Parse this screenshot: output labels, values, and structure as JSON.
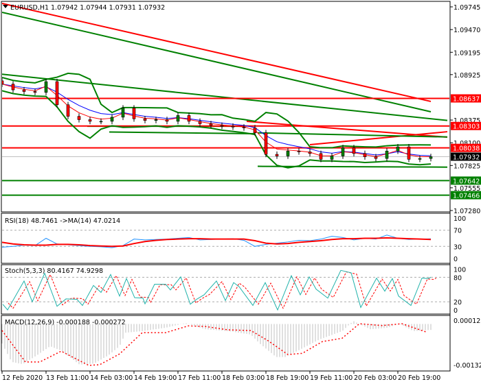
{
  "header": {
    "symbol_tf": "EURUSD,H1",
    "ohlc": "1.07942 1.07944 1.07931 1.07932"
  },
  "chart_data": [
    {
      "type": "candlestick",
      "title": "EURUSD,H1",
      "ylim": [
        1.0728,
        1.09745
      ],
      "price_ticks": [
        "1.09745",
        "1.09470",
        "1.09195",
        "1.08925",
        "1.08375",
        "1.08100",
        "1.07825",
        "1.07555",
        "1.07280"
      ],
      "time_labels": [
        "12 Feb 2020",
        "13 Feb 11:00",
        "14 Feb 03:00",
        "14 Feb 19:00",
        "17 Feb 11:00",
        "18 Feb 03:00",
        "18 Feb 19:00",
        "19 Feb 11:00",
        "20 Feb 03:00",
        "20 Feb 19:00"
      ],
      "hours_between_time_labels": 16,
      "close_step_hours": 4,
      "closes": [
        1.0881,
        1.0874,
        1.0872,
        1.0871,
        1.0884,
        1.0856,
        1.0842,
        1.0838,
        1.0836,
        1.0836,
        1.0841,
        1.0852,
        1.0839,
        1.0837,
        1.0838,
        1.0836,
        1.0843,
        1.0836,
        1.0833,
        1.0831,
        1.083,
        1.0829,
        1.0828,
        1.0822,
        1.0796,
        1.0794,
        1.08,
        1.0799,
        1.0797,
        1.079,
        1.0794,
        1.0804,
        1.0797,
        1.0793,
        1.0791,
        1.08,
        1.0805,
        1.079,
        1.0791,
        1.07932
      ],
      "levels": [
        {
          "price": "1.08637",
          "color": "#ff0000"
        },
        {
          "price": "1.08303",
          "color": "#ff0000"
        },
        {
          "price": "1.08038",
          "color": "#ff0000"
        },
        {
          "price": "1.07932",
          "color": "#000000",
          "current": true
        },
        {
          "price": "1.07642",
          "color": "#008000"
        },
        {
          "price": "1.07466",
          "color": "#008000"
        }
      ],
      "trendlines": [
        {
          "color": "#ff0000",
          "from": [
            0,
            1.09787
          ],
          "to": [
            156,
            1.086
          ]
        },
        {
          "color": "#008000",
          "from": [
            0,
            1.09679
          ],
          "to": [
            156,
            1.08475
          ]
        },
        {
          "color": "#008000",
          "from": [
            0,
            1.0893
          ],
          "to": [
            162,
            1.0837
          ]
        },
        {
          "color": "#ff0000",
          "from": [
            89,
            1.08359
          ],
          "to": [
            162,
            1.08168
          ]
        },
        {
          "color": "#ff0000",
          "from": [
            112,
            1.08077
          ],
          "to": [
            162,
            1.08234
          ]
        },
        {
          "color": "#008000",
          "from": [
            31,
            1.083
          ],
          "to": [
            88,
            1.083
          ]
        },
        {
          "color": "#008000",
          "from": [
            39,
            1.0823
          ],
          "to": [
            92,
            1.0821
          ]
        },
        {
          "color": "#008000",
          "from": [
            93,
            1.0822
          ],
          "to": [
            162,
            1.0817
          ]
        },
        {
          "color": "#008000",
          "from": [
            93,
            1.07815
          ],
          "to": [
            162,
            1.07805
          ]
        }
      ]
    },
    {
      "type": "line",
      "title": "RSI(18) 48.7461  ->MA(14) 47.0214",
      "ylim": [
        0,
        100
      ],
      "ticks": [
        "100",
        "70",
        "30",
        "0"
      ],
      "levels": [
        70,
        30
      ],
      "step_hours": 4,
      "rsi": [
        28,
        30,
        33,
        32,
        50,
        36,
        34,
        32,
        30,
        29,
        27,
        32,
        48,
        46,
        47,
        48,
        50,
        52,
        46,
        47,
        48,
        49,
        45,
        30,
        35,
        38,
        41,
        45,
        44,
        48,
        55,
        52,
        46,
        50,
        48,
        58,
        50,
        47,
        48,
        48.75
      ],
      "ma": [
        40,
        36,
        34,
        33,
        33,
        35,
        35,
        34,
        32,
        31,
        30,
        31,
        37,
        42,
        45,
        47,
        48,
        49,
        49,
        48,
        48,
        48,
        48,
        44,
        38,
        36,
        37,
        40,
        42,
        44,
        47,
        49,
        49,
        50,
        50,
        51,
        50,
        49,
        48,
        47.02
      ]
    },
    {
      "type": "line",
      "title": "Stoch(5,3,3) 80.4167 74.9298",
      "ylim": [
        0,
        100
      ],
      "ticks": [
        "100",
        "80",
        "20",
        "0"
      ],
      "levels": [
        80,
        20
      ],
      "k": [
        [
          0.25,
          14
        ],
        [
          2,
          0
        ],
        [
          8,
          71
        ],
        [
          11,
          20
        ],
        [
          15.5,
          90
        ],
        [
          20,
          9
        ],
        [
          23.25,
          27
        ],
        [
          27.25,
          26
        ],
        [
          29.25,
          11
        ],
        [
          33.25,
          60
        ],
        [
          36,
          43
        ],
        [
          39.5,
          87
        ],
        [
          42.75,
          34
        ],
        [
          45.25,
          77
        ],
        [
          48.25,
          30
        ],
        [
          51.25,
          29
        ],
        [
          52,
          15
        ],
        [
          55.5,
          63
        ],
        [
          59.5,
          63
        ],
        [
          61.25,
          49
        ],
        [
          65,
          81
        ],
        [
          68.5,
          14
        ],
        [
          70.75,
          26
        ],
        [
          73.5,
          37
        ],
        [
          78,
          71
        ],
        [
          81.25,
          23
        ],
        [
          84.25,
          67
        ],
        [
          86.25,
          57
        ],
        [
          91.25,
          11
        ],
        [
          95.75,
          67
        ],
        [
          100.25,
          0
        ],
        [
          105.25,
          84
        ],
        [
          108.5,
          37
        ],
        [
          111.75,
          81
        ],
        [
          114.25,
          51
        ],
        [
          118.5,
          29
        ],
        [
          123.25,
          97
        ],
        [
          127,
          91
        ],
        [
          130.5,
          6
        ],
        [
          136.25,
          78
        ],
        [
          139.25,
          46
        ],
        [
          142,
          77
        ],
        [
          144.25,
          34
        ],
        [
          148.75,
          11
        ],
        [
          152.75,
          78
        ],
        [
          155,
          77
        ],
        [
          156,
          80.42
        ]
      ],
      "d_lag_hours": 2
    },
    {
      "type": "bar",
      "title": "MACD(12,26,9) -0.000188 -0.000272",
      "ylim": [
        -0.001322,
        0.000123
      ],
      "ticks": [
        "0.000123",
        "-0.001322"
      ],
      "macd": [
        [
          0,
          -0.00063
        ],
        [
          3.5,
          -0.00123
        ],
        [
          7.5,
          -0.0013
        ],
        [
          12.75,
          -0.00101
        ],
        [
          17.5,
          -0.00072
        ],
        [
          21.5,
          -0.00086
        ],
        [
          28.25,
          -0.00132
        ],
        [
          33.5,
          -0.00128
        ],
        [
          38.75,
          -0.00101
        ],
        [
          42.75,
          -0.00072
        ],
        [
          45,
          -0.00028
        ],
        [
          51,
          -0.00023
        ],
        [
          59.5,
          -0.00012
        ],
        [
          66.75,
          3e-05
        ],
        [
          74,
          -0.00017
        ],
        [
          82.25,
          -0.00023
        ],
        [
          90.5,
          -0.00034
        ],
        [
          93.75,
          -0.00063
        ],
        [
          99.75,
          -0.00107
        ],
        [
          103,
          -0.00107
        ],
        [
          109.25,
          -0.00079
        ],
        [
          115.5,
          -0.0005
        ],
        [
          123.75,
          -0.00023
        ],
        [
          127.75,
          0.0001
        ],
        [
          134,
          -0.00017
        ],
        [
          140.25,
          -0.00012
        ],
        [
          144.5,
          1e-05
        ],
        [
          149.75,
          -0.00023
        ],
        [
          156.5,
          -0.000188
        ]
      ],
      "signal": [
        [
          0,
          -0.00021
        ],
        [
          8.5,
          -0.00123
        ],
        [
          13.75,
          -0.00123
        ],
        [
          21.5,
          -0.00088
        ],
        [
          31.5,
          -0.00134
        ],
        [
          35.5,
          -0.00132
        ],
        [
          42.75,
          -0.00097
        ],
        [
          51,
          -0.00028
        ],
        [
          59.5,
          -0.00028
        ],
        [
          67.75,
          -6e-05
        ],
        [
          74,
          -8e-05
        ],
        [
          82.25,
          -0.00019
        ],
        [
          90.5,
          -0.00021
        ],
        [
          96.75,
          -0.00054
        ],
        [
          104,
          -0.00099
        ],
        [
          109.25,
          -0.00095
        ],
        [
          116.5,
          -0.00057
        ],
        [
          123.75,
          -0.00046
        ],
        [
          130,
          1e-05
        ],
        [
          138.25,
          -5e-05
        ],
        [
          145.5,
          1e-05
        ],
        [
          154.75,
          -0.000272
        ]
      ]
    }
  ],
  "colors": {
    "up": "#008000",
    "down": "#ff0000",
    "ma_fast": "#ff0000",
    "ma_slow": "#0000ff",
    "band": "#008000",
    "rsi": "#1e90ff",
    "stoch": "#20b2aa"
  }
}
